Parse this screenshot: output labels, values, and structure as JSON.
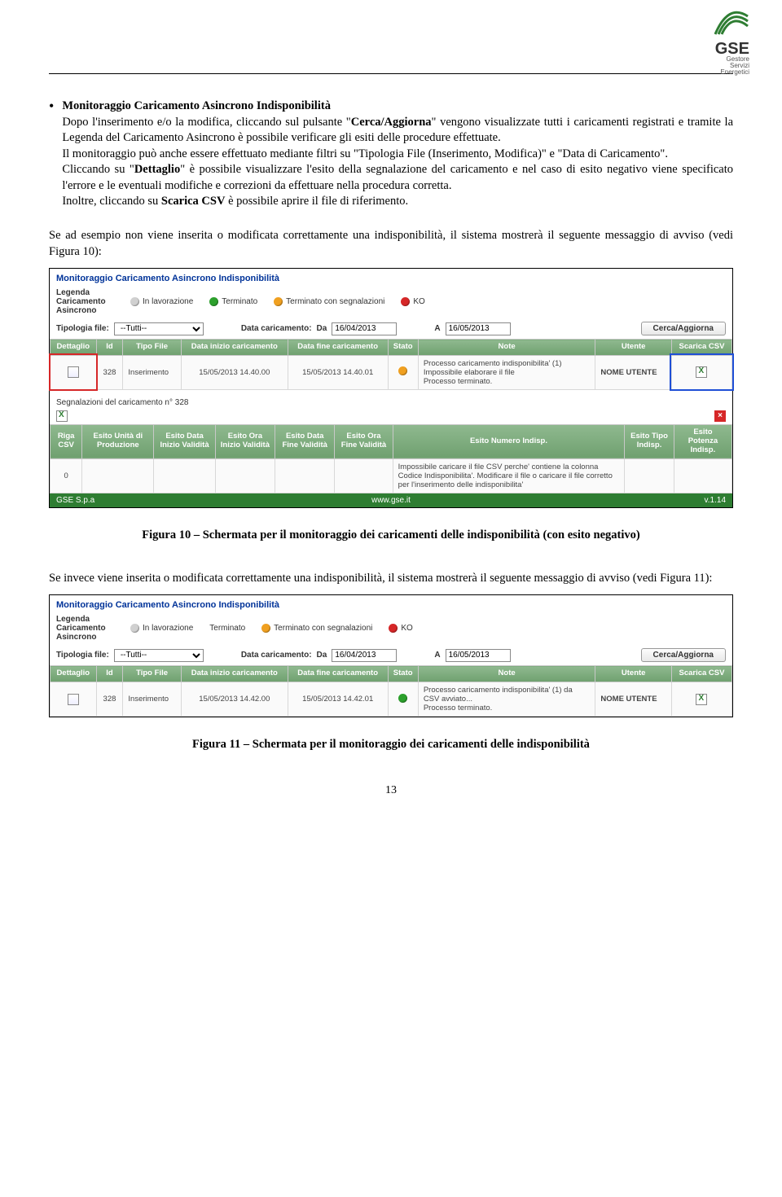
{
  "brand": {
    "name": "GSE",
    "sub1": "Gestore",
    "sub2": "Servizi",
    "sub3": "Energetici"
  },
  "p": {
    "bullet_title": "Monitoraggio Caricamento Asincrono Indisponibilità",
    "b1a": "Dopo l'inserimento e/o la modifica, cliccando sul pulsante \"",
    "b1b": "Cerca/Aggiorna",
    "b1c": "\" vengono visualizzate tutti i caricamenti registrati e tramite la Legenda del Caricamento Asincrono è possibile verificare gli esiti delle procedure effettuate.",
    "b2": "Il monitoraggio può anche essere effettuato mediante filtri su \"Tipologia File (Inserimento, Modifica)\" e \"Data di Caricamento\".",
    "b3a": "Cliccando su \"",
    "b3b": "Dettaglio",
    "b3c": "\" è possibile visualizzare l'esito della segnalazione del caricamento e nel caso di esito negativo viene specificato l'errore e le eventuali modifiche e correzioni da effettuare nella procedura corretta.",
    "b4a": "Inoltre, cliccando su ",
    "b4b": "Scarica CSV",
    "b4c": " è possibile aprire il file di riferimento.",
    "intro2": "Se ad esempio non viene inserita o modificata correttamente una indisponibilità, il sistema mostrerà il seguente messaggio di avviso (vedi Figura 10):",
    "fig10": "Figura 10 – Schermata per il monitoraggio dei caricamenti delle indisponibilità (con esito negativo)",
    "intro3": "Se invece viene inserita o modificata correttamente una indisponibilità, il sistema mostrerà il seguente messaggio di avviso (vedi Figura 11):",
    "fig11": "Figura 11 – Schermata per il monitoraggio dei caricamenti delle indisponibilità",
    "pagenum": "13"
  },
  "shot_common": {
    "title": "Monitoraggio Caricamento Asincrono Indisponibilità",
    "legend_label": "Legenda Caricamento Asincrono",
    "legend": {
      "inlav": "In lavorazione",
      "term": "Terminato",
      "seg": "Terminato con segnalazioni",
      "ko": "KO"
    },
    "f": {
      "tipologia_lbl": "Tipologia file:",
      "tipologia_val": "--Tutti--",
      "datacar_lbl": "Data caricamento:",
      "da": "Da",
      "a": "A",
      "da_val": "16/04/2013",
      "a_val": "16/05/2013",
      "btn": "Cerca/Aggiorna"
    },
    "h": {
      "det": "Dettaglio",
      "id": "Id",
      "tipo": "Tipo File",
      "dini": "Data inizio caricamento",
      "dfin": "Data fine caricamento",
      "stato": "Stato",
      "note": "Note",
      "utente": "Utente",
      "scarica": "Scarica CSV"
    }
  },
  "shot1": {
    "row": {
      "id": "328",
      "tipo": "Inserimento",
      "dini": "15/05/2013 14.40.00",
      "dfin": "15/05/2013 14.40.01",
      "note": "Processo caricamento indisponibilita' (1)\nImpossibile elaborare il file\nProcesso terminato.",
      "utente": "NOME UTENTE"
    },
    "seg_title": "Segnalazioni del caricamento n° 328",
    "h2": {
      "riga": "Riga CSV",
      "eup": "Esito Unità di Produzione",
      "edini": "Esito Data Inizio Validità",
      "eoini": "Esito Ora Inizio Validità",
      "edfin": "Esito Data Fine Validità",
      "eofin": "Esito Ora Fine Validità",
      "enum": "Esito Numero Indisp.",
      "etipo": "Esito Tipo Indisp.",
      "epot": "Esito Potenza Indisp."
    },
    "r2": {
      "riga": "0",
      "enum": "Impossibile caricare il file CSV perche' contiene la colonna Codice Indisponibilita'. Modificare il file o caricare il file corretto per l'inserimento delle indisponibilita'"
    },
    "foot": {
      "l": "GSE S.p.a",
      "c": "www.gse.it",
      "r": "v.1.14"
    }
  },
  "shot2": {
    "row": {
      "id": "328",
      "tipo": "Inserimento",
      "dini": "15/05/2013 14.42.00",
      "dfin": "15/05/2013 14.42.01",
      "note": "Processo caricamento indisponibilita' (1) da CSV avviato...\nProcesso terminato.",
      "utente": "NOME UTENTE"
    }
  }
}
